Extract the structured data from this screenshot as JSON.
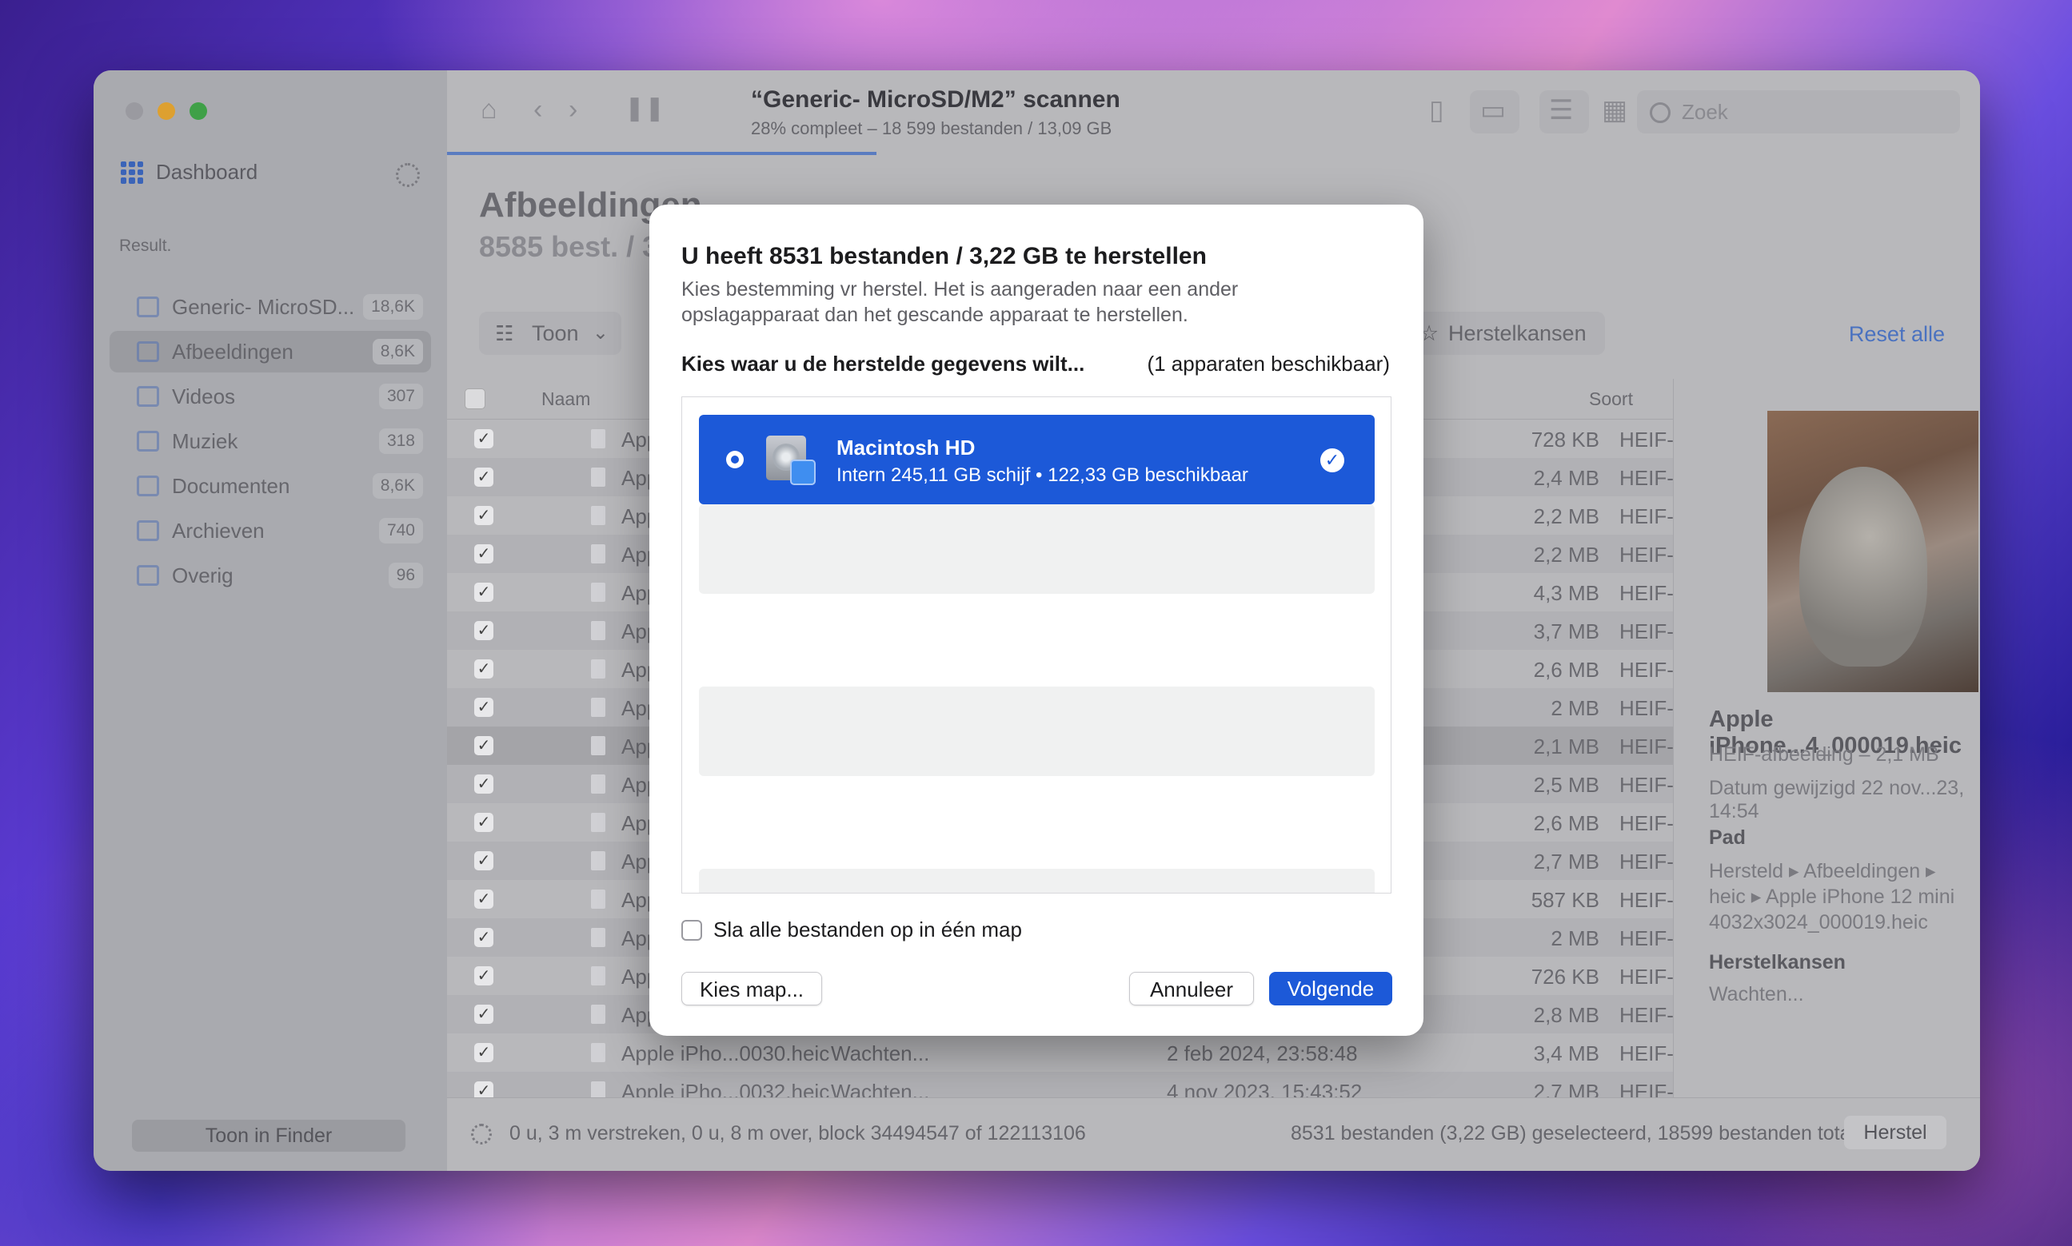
{
  "sidebar": {
    "dashboard_label": "Dashboard",
    "result_label": "Result.",
    "items": [
      {
        "label": "Generic- MicroSD...",
        "count": "18,6K",
        "icon": "drive-icon"
      },
      {
        "label": "Afbeeldingen",
        "count": "8,6K",
        "icon": "image-icon"
      },
      {
        "label": "Videos",
        "count": "307",
        "icon": "video-icon"
      },
      {
        "label": "Muziek",
        "count": "318",
        "icon": "music-icon"
      },
      {
        "label": "Documenten",
        "count": "8,6K",
        "icon": "document-icon"
      },
      {
        "label": "Archieven",
        "count": "740",
        "icon": "archive-icon"
      },
      {
        "label": "Overig",
        "count": "96",
        "icon": "other-icon"
      }
    ],
    "finder_button": "Toon in Finder"
  },
  "toolbar": {
    "scan_title": "“Generic- MicroSD/M2” scannen",
    "scan_subtitle": "28% compleet – 18 599 bestanden / 13,09 GB",
    "progress_fraction": 0.28,
    "search_placeholder": "Zoek"
  },
  "main": {
    "heading": "Afbeeldingen",
    "subheading": "8585 best. / 3",
    "toon_button": "Toon",
    "herstelkansen_button": "Herstelkansen",
    "reset_all": "Reset alle",
    "col_name": "Naam",
    "col_type": "Soort"
  },
  "table": {
    "rows": [
      {
        "name": "App",
        "status": "",
        "date": "",
        "size": "728 KB",
        "type": "HEIF-"
      },
      {
        "name": "App",
        "status": "",
        "date": "",
        "size": "2,4 MB",
        "type": "HEIF-"
      },
      {
        "name": "App",
        "status": "",
        "date": "",
        "size": "2,2 MB",
        "type": "HEIF-"
      },
      {
        "name": "App",
        "status": "",
        "date": "",
        "size": "2,2 MB",
        "type": "HEIF-"
      },
      {
        "name": "App",
        "status": "",
        "date": "",
        "size": "4,3 MB",
        "type": "HEIF-"
      },
      {
        "name": "App",
        "status": "",
        "date": "",
        "size": "3,7 MB",
        "type": "HEIF-"
      },
      {
        "name": "App",
        "status": "",
        "date": "",
        "size": "2,6 MB",
        "type": "HEIF-"
      },
      {
        "name": "App",
        "status": "",
        "date": "",
        "size": "2 MB",
        "type": "HEIF-"
      },
      {
        "name": "App",
        "status": "",
        "date": "",
        "size": "2,1 MB",
        "type": "HEIF-"
      },
      {
        "name": "App",
        "status": "",
        "date": "",
        "size": "2,5 MB",
        "type": "HEIF-"
      },
      {
        "name": "App",
        "status": "",
        "date": "",
        "size": "2,6 MB",
        "type": "HEIF-"
      },
      {
        "name": "App",
        "status": "",
        "date": "",
        "size": "2,7 MB",
        "type": "HEIF-"
      },
      {
        "name": "App",
        "status": "",
        "date": "",
        "size": "587 KB",
        "type": "HEIF-"
      },
      {
        "name": "App",
        "status": "",
        "date": "",
        "size": "2 MB",
        "type": "HEIF-"
      },
      {
        "name": "App",
        "status": "",
        "date": "",
        "size": "726 KB",
        "type": "HEIF-"
      },
      {
        "name": "App",
        "status": "",
        "date": "",
        "size": "2,8 MB",
        "type": "HEIF-"
      },
      {
        "name": "Apple iPho...0030.heic",
        "status": "Wachten...",
        "date": "2 feb 2024, 23:58:48",
        "size": "3,4 MB",
        "type": "HEIF-"
      },
      {
        "name": "Apple iPho...0032.heic",
        "status": "Wachten...",
        "date": "4 nov 2023, 15:43:52",
        "size": "2,7 MB",
        "type": "HEIF-"
      }
    ]
  },
  "preview": {
    "title": "Apple iPhone...4_000019.heic",
    "kind": "HEIF-afbeelding – 2,1 MB",
    "date": "Datum gewijzigd  22 nov...23, 14:54",
    "path_label": "Pad",
    "path_value": "Hersteld ▸ Afbeeldingen ▸ heic ▸ Apple iPhone 12 mini 4032x3024_000019.heic",
    "herstel_label": "Herstelkansen",
    "herstel_value": "Wachten..."
  },
  "footer": {
    "left": "0 u, 3 m verstreken, 0 u, 8 m over, block 34494547 of 122113106",
    "right": "8531 bestanden (3,22 GB) geselecteerd, 18599 bestanden totaal",
    "herstel_button": "Herstel"
  },
  "dialog": {
    "title": "U heeft 8531 bestanden / 3,22 GB te herstellen",
    "description": "Kies bestemming vr herstel. Het is aangeraden naar een ander opslagapparaat dan het gescande apparaat te herstellen.",
    "choose_label": "Kies waar u de herstelde gegevens wilt...",
    "available": "(1 apparaten beschikbaar)",
    "device_name": "Macintosh HD",
    "device_info": "Intern 245,11 GB schijf • 122,33 GB beschikbaar",
    "checkbox_label": "Sla alle bestanden op in één map",
    "choose_folder": "Kies map...",
    "cancel": "Annuleer",
    "next": "Volgende"
  },
  "colors": {
    "accent": "#1c59d8",
    "link": "#4a72c0"
  }
}
